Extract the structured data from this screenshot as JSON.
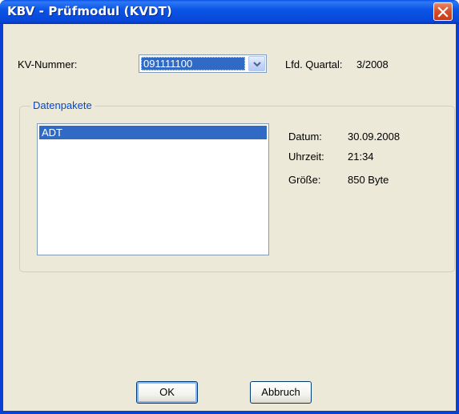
{
  "window": {
    "title": "KBV - Prüfmodul (KVDT)"
  },
  "kv": {
    "label": "KV-Nummer:",
    "value": "091111100"
  },
  "quarter": {
    "label": "Lfd. Quartal:",
    "value": "3/2008"
  },
  "group": {
    "title": "Datenpakete"
  },
  "packages": {
    "items": [
      "ADT"
    ],
    "selected": "ADT"
  },
  "details": {
    "date_label": "Datum:",
    "date_value": "30.09.2008",
    "time_label": "Uhrzeit:",
    "time_value": "21:34",
    "size_label": "Größe:",
    "size_value": "850 Byte"
  },
  "buttons": {
    "ok": "OK",
    "cancel": "Abbruch"
  },
  "colors": {
    "titlebar": "#0a4fe8",
    "selection": "#316ac5",
    "face": "#ece9d8",
    "group_title": "#0046d5"
  },
  "icons": {
    "close": "close-icon",
    "dropdown": "chevron-down-icon"
  }
}
